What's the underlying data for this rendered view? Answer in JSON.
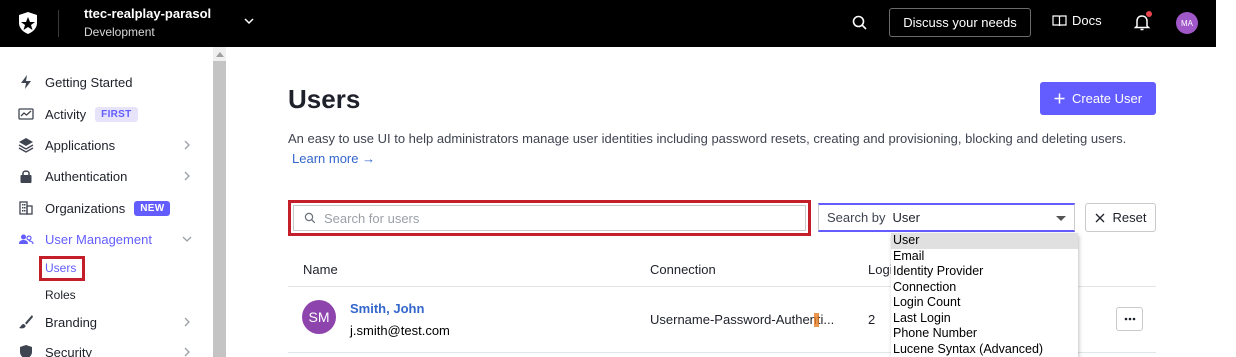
{
  "topbar": {
    "tenant_name": "ttec-realplay-parasol",
    "tenant_env": "Development",
    "discuss_label": "Discuss your needs",
    "docs_label": "Docs",
    "avatar_initials": "MA"
  },
  "sidebar": {
    "items": [
      {
        "label": "Getting Started",
        "icon": "bolt-icon"
      },
      {
        "label": "Activity",
        "icon": "activity-chart-icon",
        "badge": "FIRST"
      },
      {
        "label": "Applications",
        "icon": "layers-icon"
      },
      {
        "label": "Authentication",
        "icon": "lock-icon"
      },
      {
        "label": "Organizations",
        "icon": "building-icon",
        "badge": "NEW"
      },
      {
        "label": "User Management",
        "icon": "users-icon"
      },
      {
        "label": "Branding",
        "icon": "brush-icon"
      },
      {
        "label": "Security",
        "icon": "shield-icon"
      }
    ],
    "sub_items": [
      "Users",
      "Roles"
    ]
  },
  "main": {
    "title": "Users",
    "create_label": "Create User",
    "description": "An easy to use UI to help administrators manage user identities including password resets, creating and provisioning, blocking and deleting users.",
    "learn_more": "Learn more →",
    "search_placeholder": "Search for users",
    "search_by_label": "Search by",
    "search_by_value": "User",
    "reset_label": "Reset",
    "columns": [
      "Name",
      "Connection",
      "Logi"
    ],
    "users": [
      {
        "initials": "SM",
        "name": "Smith, John",
        "email": "j.smith@test.com",
        "connection": "Username-Password-Authenti...",
        "logins": "2"
      }
    ]
  },
  "search_by_options": [
    "User",
    "Email",
    "Identity Provider",
    "Connection",
    "Login Count",
    "Last Login",
    "Phone Number",
    "Lucene Syntax (Advanced)"
  ],
  "colors": {
    "accent": "#635dff",
    "topbar": "#000000",
    "highlight_box": "#c41e2a",
    "avatar": "#8e44ad"
  }
}
